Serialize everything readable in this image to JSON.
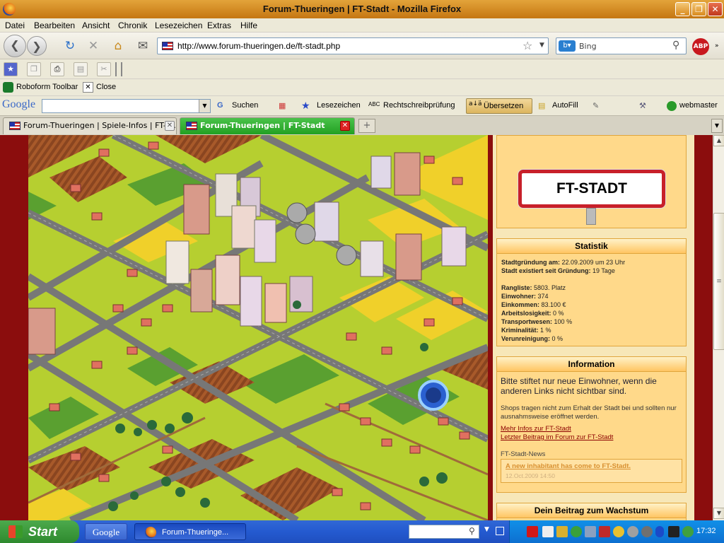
{
  "window": {
    "title": "Forum-Thueringen | FT-Stadt - Mozilla Firefox",
    "min": "_",
    "max": "❐",
    "close": "✕"
  },
  "menu": [
    "Datei",
    "Bearbeiten",
    "Ansicht",
    "Chronik",
    "Lesezeichen",
    "Extras",
    "Hilfe"
  ],
  "nav": {
    "url": "http://www.forum-thueringen.de/ft-stadt.php",
    "search_placeholder": "Bing"
  },
  "robo": {
    "toolbar_label": "Roboform Toolbar",
    "close_label": "Close"
  },
  "google_toolbar": {
    "logo": "Google",
    "search": "Suchen",
    "bookmarks": "Lesezeichen",
    "spell": "Rechtschreibprüfung",
    "translate": "Übersetzen",
    "autofill": "AutoFill",
    "user": "webmaster"
  },
  "tabs": [
    {
      "label": "Forum-Thueringen | Spiele-Infos | FT-S..."
    },
    {
      "label": "Forum-Thueringen | FT-Stadt"
    }
  ],
  "sign": {
    "text": "FT-STADT"
  },
  "statistik": {
    "title": "Statistik",
    "founded_label": "Stadtgründung am:",
    "founded_value": "22.09.2009 um 23 Uhr",
    "since_label": "Stadt existiert seit Gründung:",
    "since_value": "19 Tage",
    "rows": [
      {
        "label": "Rangliste:",
        "value": "5803. Platz"
      },
      {
        "label": "Einwohner:",
        "value": "374"
      },
      {
        "label": "Einkommen:",
        "value": "83.100 €"
      },
      {
        "label": "Arbeitslosigkeit:",
        "value": "0 %"
      },
      {
        "label": "Transportwesen:",
        "value": "100 %"
      },
      {
        "label": "Kriminalität:",
        "value": "1 %"
      },
      {
        "label": "Verunreinigung:",
        "value": "0 %"
      }
    ]
  },
  "information": {
    "title": "Information",
    "headline": "Bitte stiftet nur neue Einwohner, wenn die anderen Links nicht sichtbar sind.",
    "note": "Shops tragen nicht zum Erhalt der Stadt bei und sollten nur ausnahmsweise eröffnet werden.",
    "link1": "Mehr Infos zur FT-Stadt",
    "link2": "Letzter Beitrag im Forum zur FT-Stadt",
    "news_label": "FT-Stadt-News",
    "news_title": "A new inhabitant has come to FT-Stadt.",
    "news_date": "12.Oct.2009 14:50"
  },
  "beitrag": {
    "title": "Dein Beitrag zum Wachstum"
  },
  "taskbar": {
    "start": "Start",
    "google": "Google",
    "window": "Forum-Thueringe...",
    "clock": "17:32"
  }
}
